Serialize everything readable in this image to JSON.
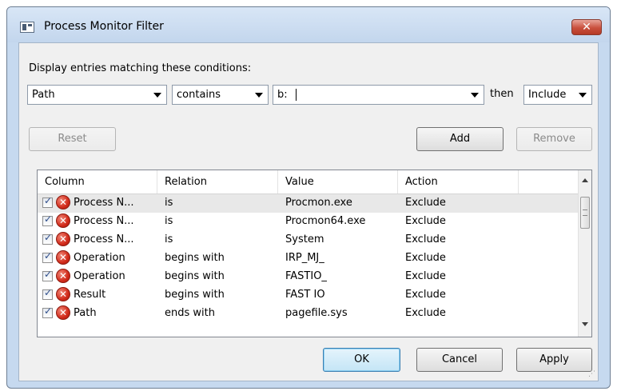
{
  "window": {
    "title": "Process Monitor Filter",
    "close_label": "✕"
  },
  "filter": {
    "prompt": "Display entries matching these conditions:",
    "column_value": "Path",
    "relation_value": "contains",
    "value_text": "b:",
    "then_label": "then",
    "action_value": "Include"
  },
  "buttons": {
    "reset": "Reset",
    "add": "Add",
    "remove": "Remove",
    "ok": "OK",
    "cancel": "Cancel",
    "apply": "Apply"
  },
  "table": {
    "headers": [
      "Column",
      "Relation",
      "Value",
      "Action"
    ],
    "rows": [
      {
        "column": "Process N...",
        "relation": "is",
        "value": "Procmon.exe",
        "action": "Exclude"
      },
      {
        "column": "Process N...",
        "relation": "is",
        "value": "Procmon64.exe",
        "action": "Exclude"
      },
      {
        "column": "Process N...",
        "relation": "is",
        "value": "System",
        "action": "Exclude"
      },
      {
        "column": "Operation",
        "relation": "begins with",
        "value": "IRP_MJ_",
        "action": "Exclude"
      },
      {
        "column": "Operation",
        "relation": "begins with",
        "value": "FASTIO_",
        "action": "Exclude"
      },
      {
        "column": "Result",
        "relation": "begins with",
        "value": "FAST IO",
        "action": "Exclude"
      },
      {
        "column": "Path",
        "relation": "ends with",
        "value": "pagefile.sys",
        "action": "Exclude"
      }
    ]
  },
  "icons": {
    "title": "window-icon",
    "exclude": "exclude-x-icon",
    "check": "checkbox-checked"
  }
}
